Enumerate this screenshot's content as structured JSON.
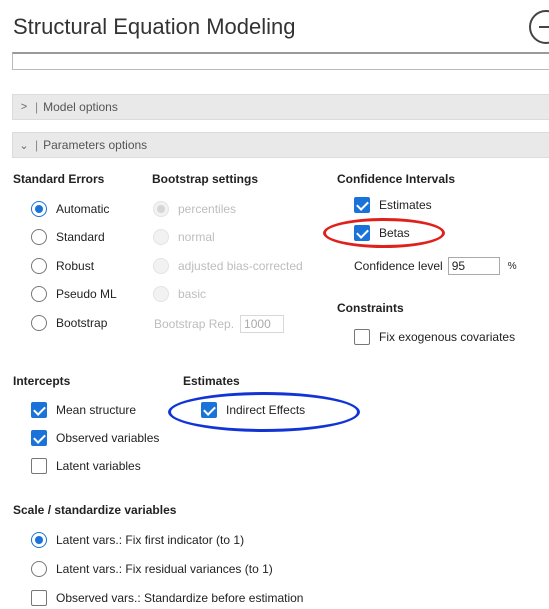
{
  "title": "Structural Equation Modeling",
  "sections": {
    "model_options": "Model options",
    "parameters_options": "Parameters options"
  },
  "standard_errors": {
    "heading": "Standard Errors",
    "options": [
      "Automatic",
      "Standard",
      "Robust",
      "Pseudo ML",
      "Bootstrap"
    ],
    "selected": "Automatic"
  },
  "bootstrap": {
    "heading": "Bootstrap settings",
    "options": [
      "percentiles",
      "normal",
      "adjusted bias-corrected",
      "basic"
    ],
    "selected": "percentiles",
    "rep_label": "Bootstrap Rep.",
    "rep_value": "1000"
  },
  "confidence_intervals": {
    "heading": "Confidence Intervals",
    "estimates": "Estimates",
    "betas": "Betas",
    "level_label": "Confidence level",
    "level_value": "95",
    "unit": "%"
  },
  "constraints": {
    "heading": "Constraints",
    "fix_exo": "Fix exogenous covariates"
  },
  "intercepts": {
    "heading": "Intercepts",
    "mean_structure": "Mean structure",
    "observed": "Observed variables",
    "latent": "Latent variables"
  },
  "estimates": {
    "heading": "Estimates",
    "indirect": "Indirect Effects"
  },
  "scale": {
    "heading": "Scale / standardize variables",
    "fix_first": "Latent vars.: Fix first indicator (to 1)",
    "fix_resid": "Latent vars.: Fix residual variances (to 1)",
    "std_before": "Observed vars.: Standardize before estimation"
  },
  "annotations": {
    "red_color": "#e0201b",
    "blue_color": "#1234d6"
  },
  "accent_color": "#1a73d9"
}
